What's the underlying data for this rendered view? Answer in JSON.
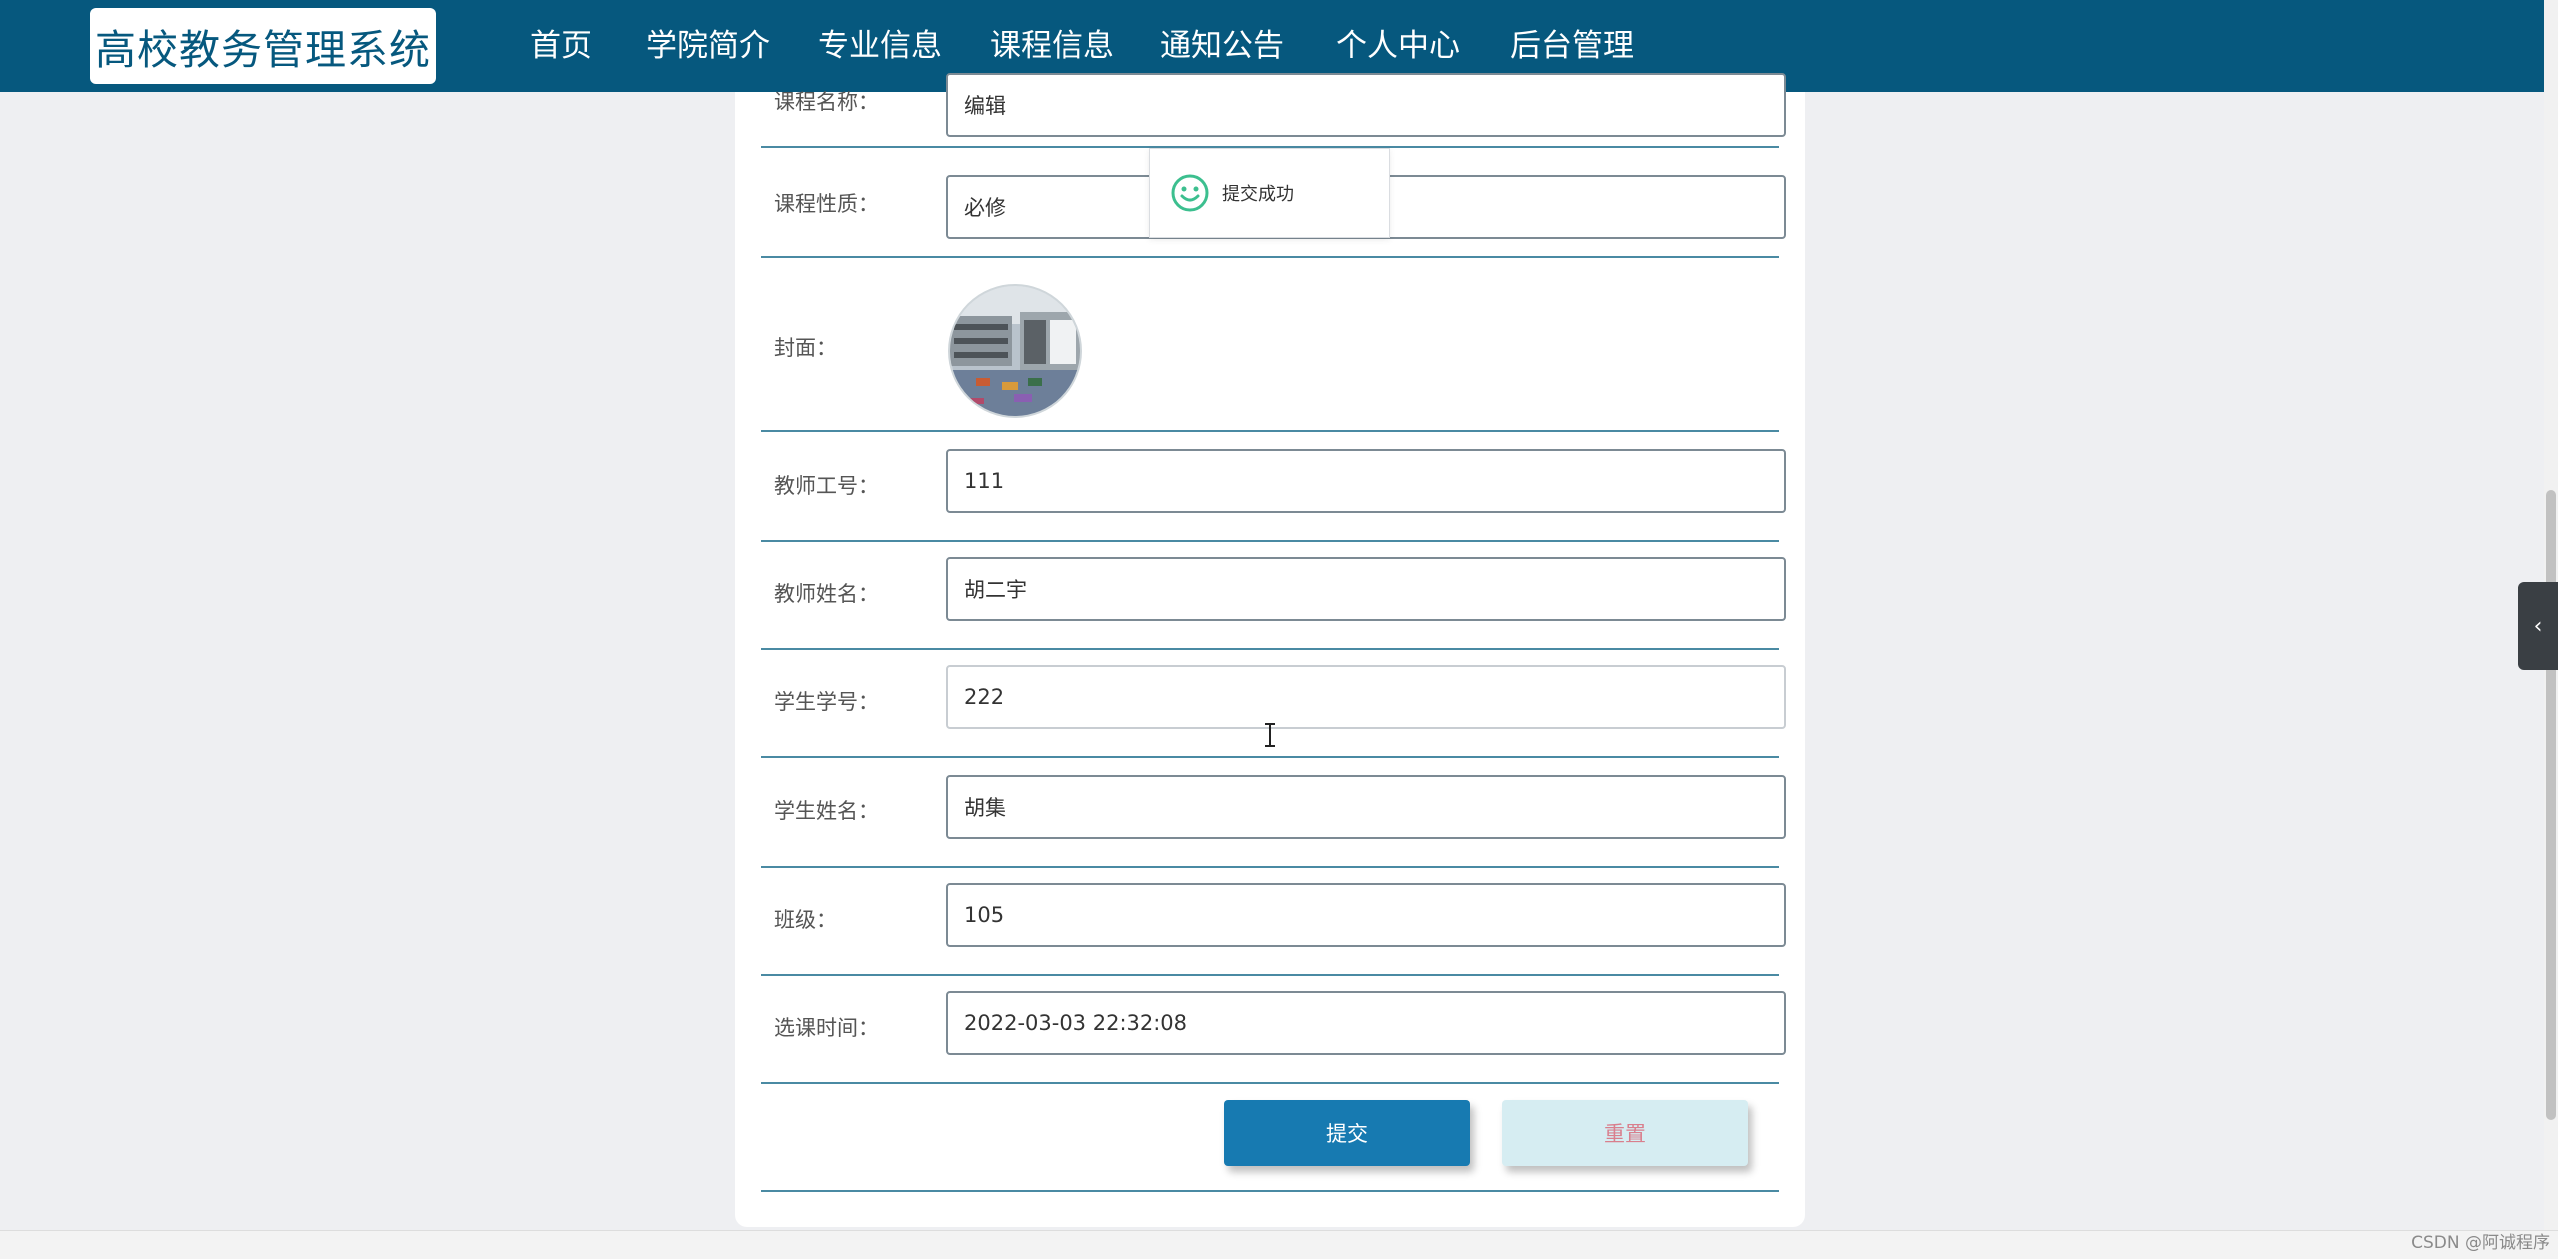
{
  "nav": {
    "logo": "高校教务管理系统",
    "items": [
      {
        "label": "首页"
      },
      {
        "label": "学院简介"
      },
      {
        "label": "专业信息"
      },
      {
        "label": "课程信息"
      },
      {
        "label": "通知公告"
      },
      {
        "label": "个人中心"
      },
      {
        "label": "后台管理"
      }
    ],
    "active": "课程信息"
  },
  "form": {
    "course_name": {
      "label": "课程名称：",
      "value": "编辑"
    },
    "course_type": {
      "label": "课程性质：",
      "value": "必修"
    },
    "cover": {
      "label": "封面："
    },
    "teacher_id": {
      "label": "教师工号：",
      "value": "111"
    },
    "teacher_name": {
      "label": "教师姓名：",
      "value": "胡二宇"
    },
    "student_id": {
      "label": "学生学号：",
      "value": "222"
    },
    "student_name": {
      "label": "学生姓名：",
      "value": "胡集"
    },
    "class": {
      "label": "班级：",
      "value": "105"
    },
    "select_time": {
      "label": "选课时间：",
      "value": "2022-03-03 22:32:08"
    }
  },
  "buttons": {
    "submit": "提交",
    "reset": "重置"
  },
  "toast": {
    "icon": "smile-icon",
    "text": "提交成功"
  },
  "watermark": "CSDN @阿诚程序",
  "colors": {
    "nav_bg": "#06587e",
    "submit_bg": "#177ab1",
    "reset_bg": "#d6edf2",
    "toast_icon": "#3cbf8f"
  }
}
